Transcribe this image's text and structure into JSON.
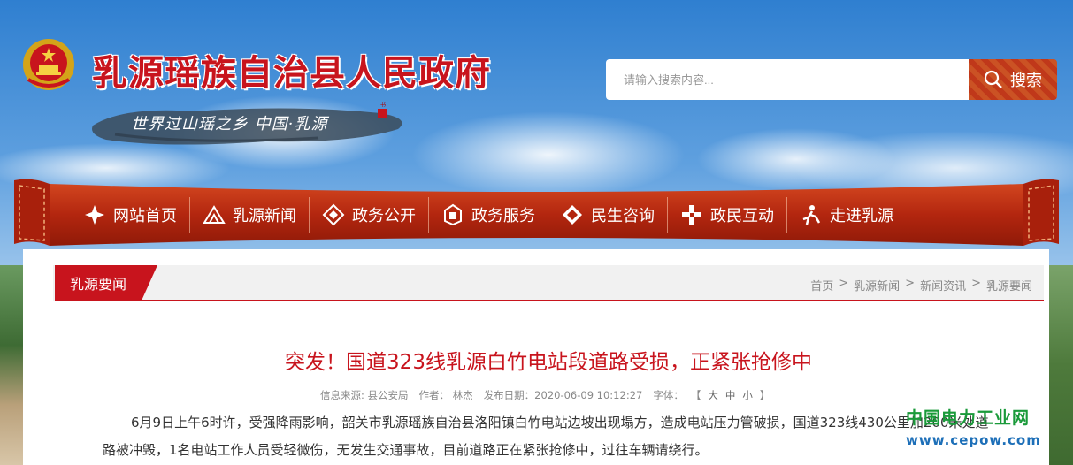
{
  "header": {
    "site_title": "乳源瑶族自治县人民政府",
    "slogan": "世界过山瑶之乡  中国·乳源",
    "emblem_icon": "national-emblem-icon"
  },
  "search": {
    "placeholder": "请输入搜索内容...",
    "button_label": "搜索",
    "icon": "search-icon"
  },
  "nav": {
    "items": [
      {
        "label": "网站首页",
        "icon": "home-pattern-icon"
      },
      {
        "label": "乳源新闻",
        "icon": "news-pattern-icon"
      },
      {
        "label": "政务公开",
        "icon": "gov-pattern-icon"
      },
      {
        "label": "政务服务",
        "icon": "service-pattern-icon"
      },
      {
        "label": "民生咨询",
        "icon": "consult-pattern-icon"
      },
      {
        "label": "政民互动",
        "icon": "interact-pattern-icon"
      },
      {
        "label": "走进乳源",
        "icon": "explore-pattern-icon"
      }
    ]
  },
  "section": {
    "tab_label": "乳源要闻"
  },
  "breadcrumb": {
    "items": [
      "首页",
      "乳源新闻",
      "新闻资讯",
      "乳源要闻"
    ],
    "separator": ">"
  },
  "article": {
    "title": "突发！国道323线乳源白竹电站段道路受损，正紧张抢修中",
    "source": "信息来源: 县公安局",
    "author": "作者：  林杰",
    "date": "发布日期：2020-06-09 10:12:27",
    "font_size_label": "字体：",
    "size_open": "【",
    "size_large": "大",
    "size_medium": "中",
    "size_small": "小",
    "size_close": "】",
    "body": "6月9日上午6时许，受强降雨影响，韶关市乳源瑶族自治县洛阳镇白竹电站边坡出现塌方，造成电站压力管破损，国道323线430公里加200米处道路被冲毁，1名电站工作人员受轻微伤，无发生交通事故，目前道路正在紧张抢修中，过往车辆请绕行。"
  },
  "watermark": {
    "name": "中国电力工业网",
    "url": "www.cepow.com"
  },
  "colors": {
    "brand_red": "#c8141d",
    "nav_red": "#b52a10",
    "watermark_green": "#1a9a3a",
    "watermark_blue": "#1d6fb8"
  }
}
